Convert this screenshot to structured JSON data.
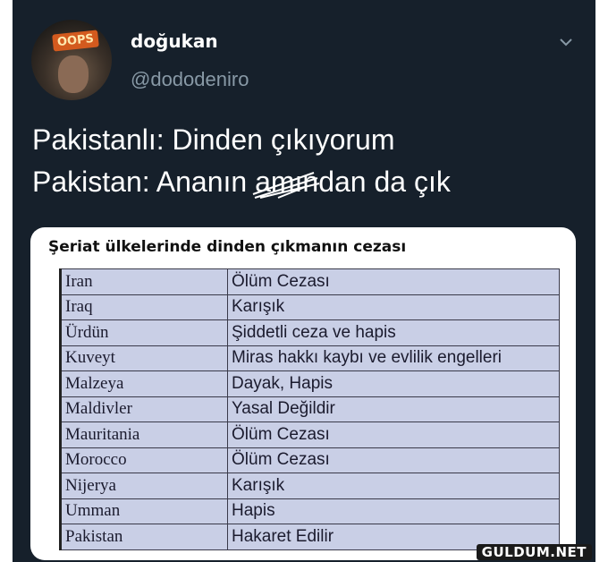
{
  "user": {
    "display_name": "doğukan",
    "handle": "@dododeniro",
    "avatar_label": "OOPS"
  },
  "tweet": {
    "line1": "Pakistanlı: Dinden çıkıyorum",
    "line2_before": "Pakistan: Ananın ",
    "line2_censored": "am",
    "line2_after": "ından da çık"
  },
  "image": {
    "title": "Şeriat ülkelerinde dinden çıkmanın cezası",
    "rows": [
      {
        "country": "Iran",
        "penalty": "Ölüm Cezası"
      },
      {
        "country": "Iraq",
        "penalty": "Karışık"
      },
      {
        "country": "Ürdün",
        "penalty": "Şiddetli ceza ve hapis"
      },
      {
        "country": "Kuveyt",
        "penalty": "Miras hakkı kaybı ve evlilik engelleri"
      },
      {
        "country": "Malzeya",
        "penalty": "Dayak, Hapis"
      },
      {
        "country": "Maldivler",
        "penalty": "Yasal Değildir"
      },
      {
        "country": "Mauritania",
        "penalty": "Ölüm Cezası"
      },
      {
        "country": "Morocco",
        "penalty": "Ölüm Cezası"
      },
      {
        "country": "Nijerya",
        "penalty": "Karışık"
      },
      {
        "country": "Umman",
        "penalty": "Hapis"
      },
      {
        "country": "Pakistan",
        "penalty": "Hakaret Edilir"
      }
    ]
  },
  "watermark": "GULDUM.NET",
  "colors": {
    "background": "#16202b",
    "text": "#ffffff",
    "handle": "#8899a6",
    "table_fill": "#c9cfe6"
  }
}
